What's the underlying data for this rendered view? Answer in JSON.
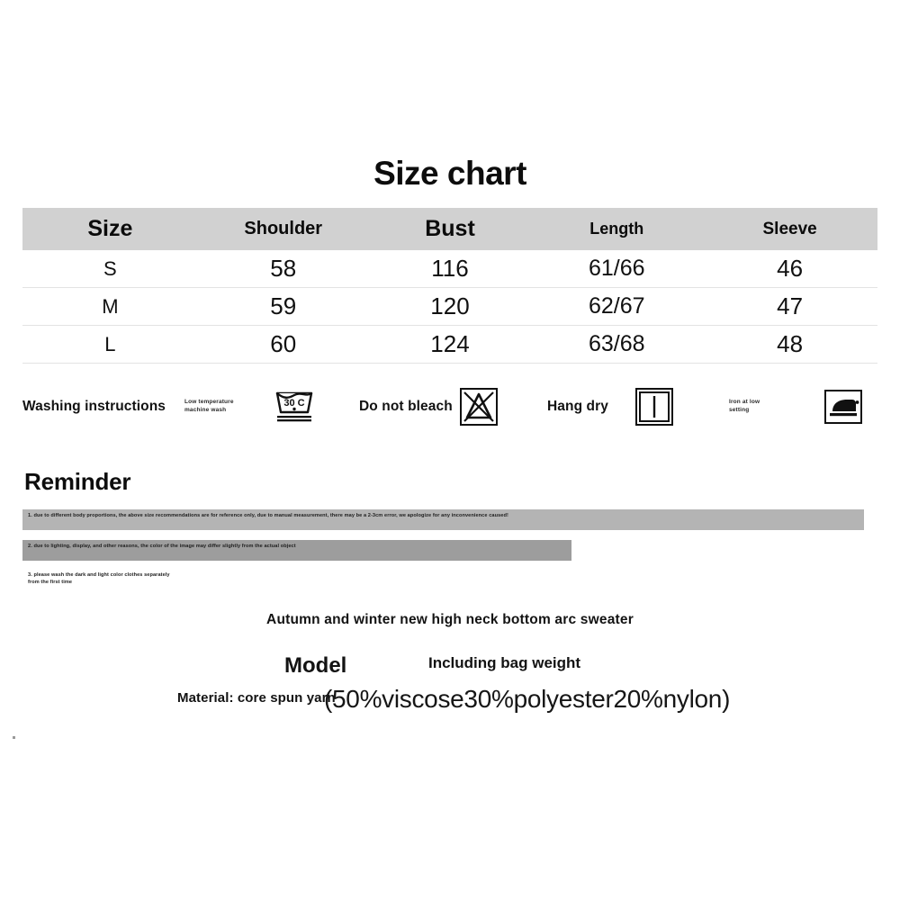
{
  "title": "Size chart",
  "table": {
    "headers": [
      "Size",
      "Shoulder",
      "Bust",
      "Length",
      "Sleeve"
    ],
    "rows": [
      {
        "size": "S",
        "shoulder": "58",
        "bust": "116",
        "length": "61/66",
        "sleeve": "46"
      },
      {
        "size": "M",
        "shoulder": "59",
        "bust": "120",
        "length": "62/67",
        "sleeve": "47"
      },
      {
        "size": "L",
        "shoulder": "60",
        "bust": "124",
        "length": "63/68",
        "sleeve": "48"
      }
    ],
    "header_bg": "#d1d1d1",
    "row_divider": "#e3e3e3"
  },
  "care": {
    "washing_instructions_label": "Washing instructions",
    "low_temp_label": "Low temperature\nmachine wash",
    "low_temp_line1": "Low temperature",
    "low_temp_line2": "machine wash",
    "wash_tub_temperature": "30 C",
    "do_not_bleach_label": "Do not bleach",
    "hang_dry_label": "Hang dry",
    "iron_line1": "Iron at low",
    "iron_line2": "setting"
  },
  "reminder": {
    "heading": "Reminder",
    "items": [
      "1. due to different body proportions, the above size recommendations are for reference only, due to manual measurement, there may be a 2-3cm error, we apologize for any inconvenience caused!",
      "2. due to lighting, display, and other reasons, the color of the image may differ slightly from the actual object",
      "3. please wash the dark and light color clothes separately from the first time"
    ],
    "bar_colors": [
      "#b4b4b4",
      "#9d9d9d",
      "#ffffff"
    ]
  },
  "footer": {
    "product_name": "Autumn and winter new high neck bottom arc sweater",
    "model_label": "Model",
    "bag_weight_label": "Including bag weight",
    "material_label": "Material: core spun yarn",
    "material_value": "(50%viscose30%polyester20%nylon)"
  }
}
